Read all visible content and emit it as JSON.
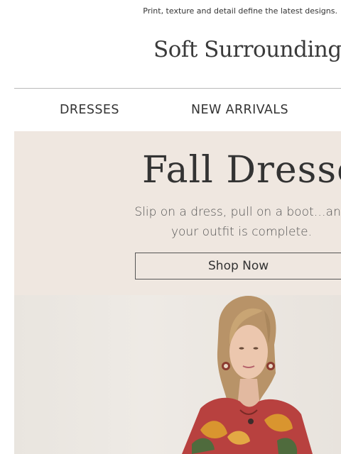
{
  "preheader": "Print, texture and detail define the latest designs.",
  "brand": {
    "name": "Soft Surroundings",
    "mark": "®"
  },
  "nav": [
    {
      "label": "DRESSES"
    },
    {
      "label": "NEW ARRIVALS"
    }
  ],
  "hero": {
    "title": "Fall Dresses",
    "subtitle_line1": "Slip on a dress, pull on a boot…and",
    "subtitle_line2": "your outfit is complete.",
    "cta": "Shop Now"
  },
  "colors": {
    "hero_bg": "#efe7e0",
    "text": "#333333",
    "dress_red": "#b8413f",
    "dress_gold": "#d9952f",
    "dress_green": "#4f6b3d"
  },
  "icons": [
    "woman-in-floral-dress-photo"
  ]
}
